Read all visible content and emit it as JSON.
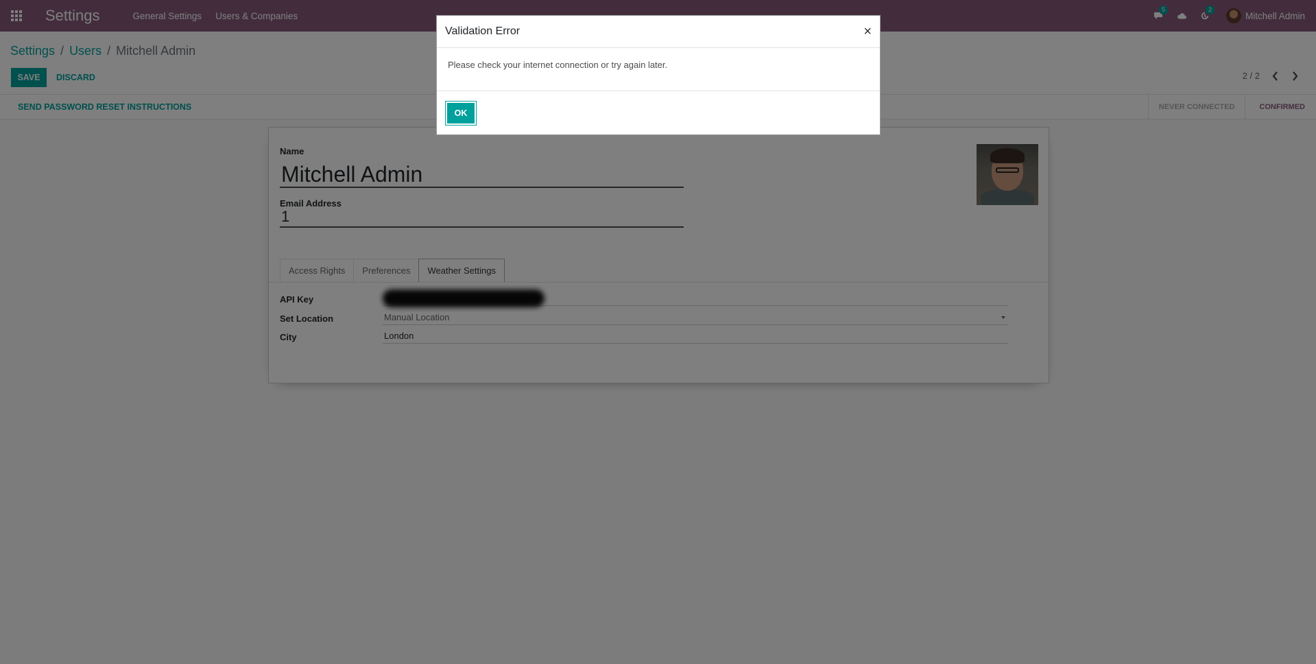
{
  "navbar": {
    "app_title": "Settings",
    "menu": [
      "General Settings",
      "Users & Companies"
    ],
    "messages_badge": "5",
    "activities_badge": "2",
    "user_name": "Mitchell Admin"
  },
  "breadcrumb": {
    "items": [
      "Settings",
      "Users"
    ],
    "current": "Mitchell Admin",
    "separator": "/"
  },
  "toolbar": {
    "save_label": "SAVE",
    "discard_label": "DISCARD",
    "pager": "2 / 2"
  },
  "statusbar": {
    "reset_label": "SEND PASSWORD RESET INSTRUCTIONS",
    "states": [
      "NEVER CONNECTED",
      "CONFIRMED"
    ],
    "active_state": "CONFIRMED"
  },
  "form": {
    "name_label": "Name",
    "name_value": "Mitchell Admin",
    "email_label": "Email Address",
    "email_value": "1",
    "tabs": [
      "Access Rights",
      "Preferences",
      "Weather Settings"
    ],
    "active_tab": "Weather Settings",
    "fields": {
      "api_key_label": "API Key",
      "set_location_label": "Set Location",
      "set_location_value": "Manual Location",
      "city_label": "City",
      "city_value": "London"
    }
  },
  "dialog": {
    "title": "Validation Error",
    "close_glyph": "×",
    "message": "Please check your internet connection or try again later.",
    "ok_label": "OK"
  },
  "colors": {
    "navbar": "#875a7b",
    "accent": "#00a09d",
    "backdrop": "rgba(0,0,0,0.5)"
  }
}
